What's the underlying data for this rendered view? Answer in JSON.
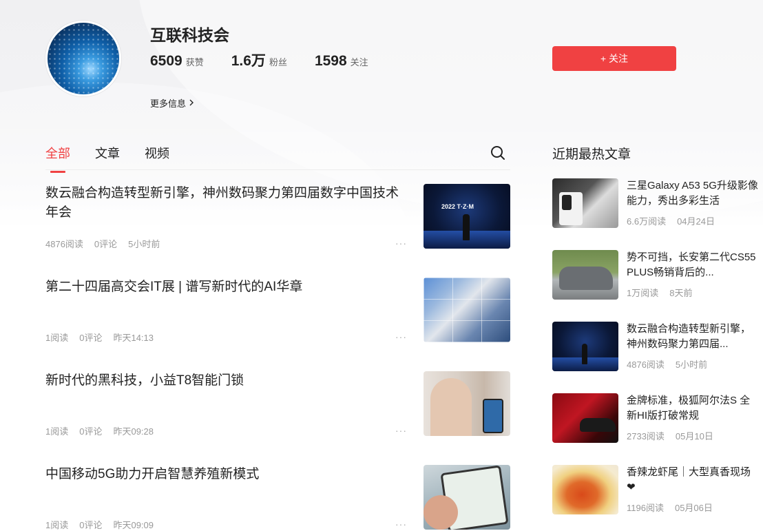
{
  "profile": {
    "name": "互联科技会",
    "stats": [
      {
        "value": "6509",
        "label": "获赞"
      },
      {
        "value": "1.6万",
        "label": "粉丝"
      },
      {
        "value": "1598",
        "label": "关注"
      }
    ],
    "more_info": "更多信息",
    "follow_label": "+ 关注"
  },
  "tabs": [
    "全部",
    "文章",
    "视频"
  ],
  "feed": [
    {
      "title": "数云融合构造转型新引擎，神州数码聚力第四届数字中国技术年会",
      "reads": "4876阅读",
      "comments": "0评论",
      "time": "5小时前",
      "thumb_text": "2022 T·Z·M"
    },
    {
      "title": "第二十四届高交会IT展 | 谱写新时代的AI华章",
      "reads": "1阅读",
      "comments": "0评论",
      "time": "昨天14:13"
    },
    {
      "title": "新时代的黑科技，小益T8智能门锁",
      "reads": "1阅读",
      "comments": "0评论",
      "time": "昨天09:28"
    },
    {
      "title": "中国移动5G助力开启智慧养殖新模式",
      "reads": "1阅读",
      "comments": "0评论",
      "time": "昨天09:09"
    }
  ],
  "more_dots": "···",
  "hot": {
    "title": "近期最热文章",
    "items": [
      {
        "title": "三星Galaxy A53 5G升级影像能力，秀出多彩生活",
        "reads": "6.6万阅读",
        "date": "04月24日"
      },
      {
        "title": "势不可挡，长安第二代CS55 PLUS畅销背后的...",
        "reads": "1万阅读",
        "date": "8天前"
      },
      {
        "title": "数云融合构造转型新引擎，神州数码聚力第四届...",
        "reads": "4876阅读",
        "date": "5小时前"
      },
      {
        "title": "金牌标准，极狐阿尔法S 全新HI版打破常规",
        "reads": "2733阅读",
        "date": "05月10日"
      },
      {
        "title": "香辣龙虾尾｜大型真香现场❤",
        "reads": "1196阅读",
        "date": "05月06日"
      }
    ]
  },
  "colors": {
    "accent": "#f04142"
  }
}
